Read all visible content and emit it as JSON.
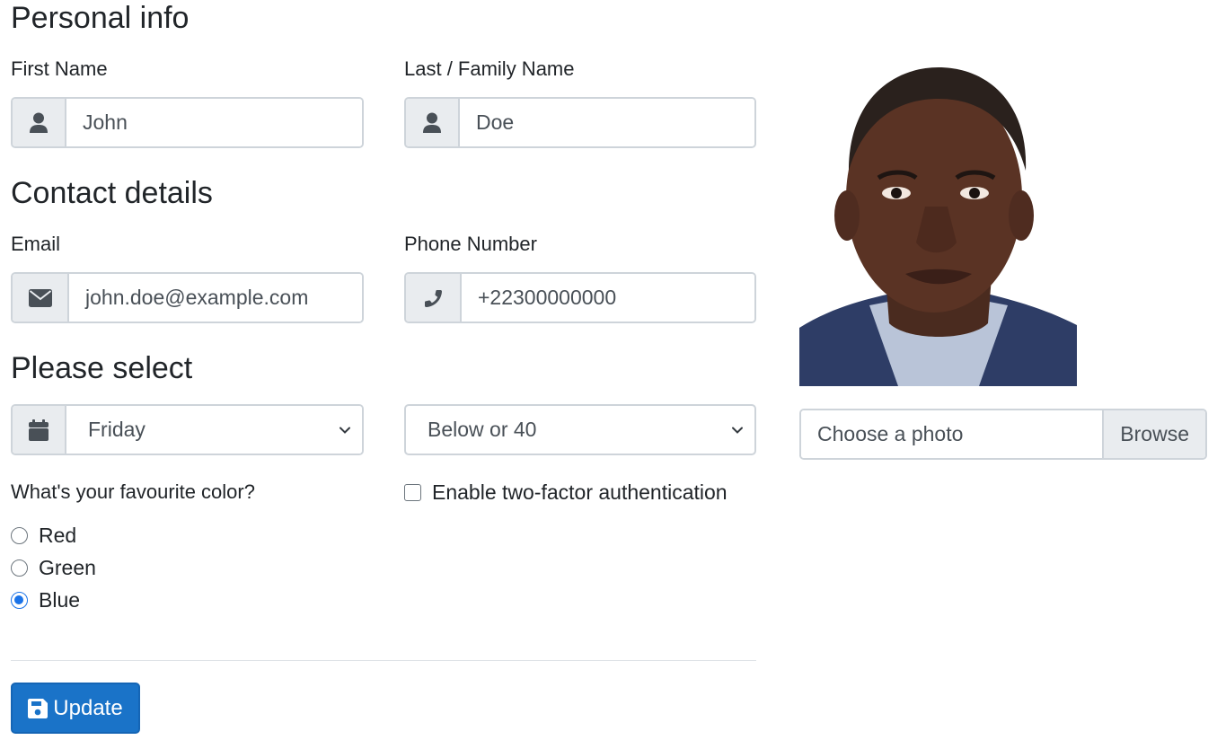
{
  "personal": {
    "title": "Personal info",
    "first_name_label": "First Name",
    "first_name_value": "John",
    "last_name_label": "Last / Family Name",
    "last_name_value": "Doe"
  },
  "contact": {
    "title": "Contact details",
    "email_label": "Email",
    "email_value": "john.doe@example.com",
    "phone_label": "Phone Number",
    "phone_value": "+22300000000"
  },
  "select_section": {
    "title": "Please select",
    "day_selected": "Friday",
    "age_selected": "Below or 40"
  },
  "color_question": {
    "label": "What's your favourite color?",
    "options": [
      "Red",
      "Green",
      "Blue"
    ],
    "selected": "Blue"
  },
  "two_factor": {
    "label": "Enable two-factor authentication",
    "checked": false
  },
  "photo": {
    "file_placeholder": "Choose a photo",
    "browse_label": "Browse"
  },
  "actions": {
    "update_label": "Update"
  },
  "colors": {
    "primary": "#1a73c8",
    "border": "#ced4da",
    "addon_bg": "#e9ecef",
    "radio_checked": "#1a73e8"
  },
  "icons": {
    "first_name": "user-icon",
    "last_name": "user-icon",
    "email": "envelope-icon",
    "phone": "phone-icon",
    "day": "calendar-icon",
    "update": "save-icon"
  }
}
